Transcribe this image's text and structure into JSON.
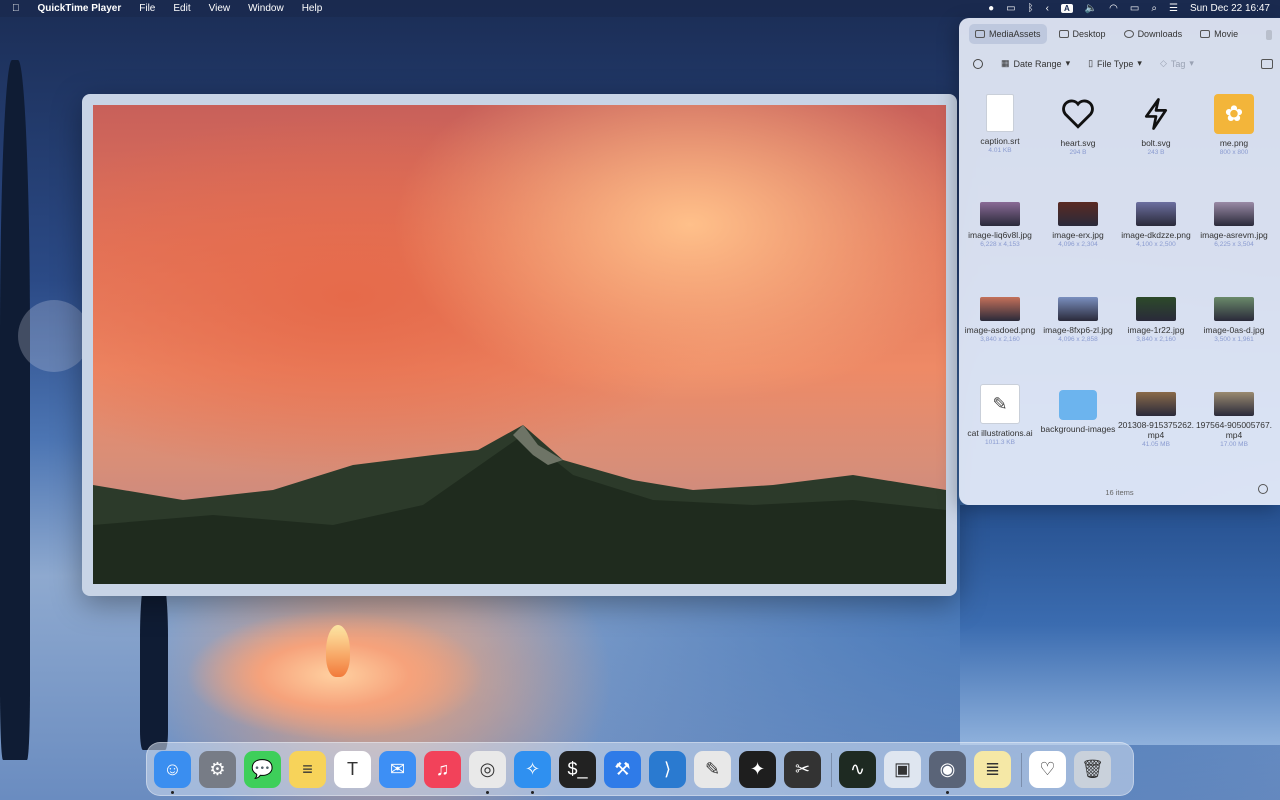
{
  "menubar": {
    "app_name": "QuickTime Player",
    "menus": [
      "File",
      "Edit",
      "View",
      "Window",
      "Help"
    ],
    "input_source": "A",
    "datetime": "Sun Dec 22  16:47"
  },
  "panel": {
    "tabs": [
      {
        "label": "MediaAssets",
        "icon": "folder-icon",
        "active": true
      },
      {
        "label": "Desktop",
        "icon": "desktop-icon",
        "active": false
      },
      {
        "label": "Downloads",
        "icon": "download-icon",
        "active": false
      },
      {
        "label": "Movie",
        "icon": "film-icon",
        "active": false
      }
    ],
    "filters": {
      "date_range": "Date Range",
      "file_type": "File Type",
      "tag": "Tag"
    },
    "files": [
      {
        "name": "caption.srt",
        "meta": "4.01 KB",
        "kind": "doc"
      },
      {
        "name": "heart.svg",
        "meta": "294 B",
        "kind": "heart"
      },
      {
        "name": "bolt.svg",
        "meta": "243 B",
        "kind": "bolt"
      },
      {
        "name": "me.png",
        "meta": "800 x 800",
        "kind": "bunny"
      },
      {
        "name": "image-liq6v8l.jpg",
        "meta": "6,228 x 4,153",
        "kind": "img",
        "color": "#8a6a96"
      },
      {
        "name": "image-erx.jpg",
        "meta": "4,096 x 2,304",
        "kind": "img",
        "color": "#5a2a22"
      },
      {
        "name": "image-dkdzze.png",
        "meta": "4,100 x 2,500",
        "kind": "img",
        "color": "#6c6fa0"
      },
      {
        "name": "image-asrevm.jpg",
        "meta": "6,225 x 3,504",
        "kind": "img",
        "color": "#9a8aa6"
      },
      {
        "name": "image-asdoed.png",
        "meta": "3,840 x 2,160",
        "kind": "img",
        "color": "#c4705a"
      },
      {
        "name": "image-8fxp6-zl.jpg",
        "meta": "4,096 x 2,858",
        "kind": "img",
        "color": "#7a8fbf"
      },
      {
        "name": "image-1r22.jpg",
        "meta": "3,840 x 2,160",
        "kind": "img",
        "color": "#2c4a2a"
      },
      {
        "name": "image-0as-d.jpg",
        "meta": "3,500 x 1,961",
        "kind": "img",
        "color": "#6a8a6a"
      },
      {
        "name": "cat illustrations.ai",
        "meta": "1011.3 KB",
        "kind": "cat"
      },
      {
        "name": "background-images",
        "meta": "",
        "kind": "folder"
      },
      {
        "name": "201308-915375262.mp4",
        "meta": "41.05 MB",
        "kind": "img",
        "color": "#8a6a4a"
      },
      {
        "name": "197564-905005767.mp4",
        "meta": "17.00 MB",
        "kind": "img",
        "color": "#9a8a70"
      }
    ],
    "item_count": "16 items"
  },
  "dock": {
    "apps": [
      {
        "name": "finder",
        "color": "#3a8ef0",
        "glyph": "☺",
        "running": true
      },
      {
        "name": "system-settings",
        "color": "#777c86",
        "glyph": "⚙",
        "running": false
      },
      {
        "name": "messages",
        "color": "#3ecf5a",
        "glyph": "💬",
        "running": false
      },
      {
        "name": "notes",
        "color": "#f7d35a",
        "glyph": "≡",
        "running": false
      },
      {
        "name": "typora",
        "color": "#ffffff",
        "glyph": "T",
        "running": false
      },
      {
        "name": "mail",
        "color": "#3d8ff5",
        "glyph": "✉",
        "running": false
      },
      {
        "name": "music",
        "color": "#f2425a",
        "glyph": "♫",
        "running": false
      },
      {
        "name": "chrome",
        "color": "#e9e9e9",
        "glyph": "◎",
        "running": true
      },
      {
        "name": "safari",
        "color": "#2f90f0",
        "glyph": "✧",
        "running": true
      },
      {
        "name": "terminal",
        "color": "#222222",
        "glyph": "$_",
        "running": false
      },
      {
        "name": "xcode",
        "color": "#2f7be8",
        "glyph": "⚒",
        "running": false
      },
      {
        "name": "vscode",
        "color": "#2a7ad0",
        "glyph": "⟩",
        "running": false
      },
      {
        "name": "pixelmator",
        "color": "#e8e8e8",
        "glyph": "✎",
        "running": false
      },
      {
        "name": "figma",
        "color": "#1e1e1e",
        "glyph": "✦",
        "running": false
      },
      {
        "name": "final-cut",
        "color": "#333333",
        "glyph": "✂",
        "running": false
      },
      {
        "name": "activity-monitor",
        "color": "#1e2a22",
        "glyph": "∿",
        "running": false
      },
      {
        "name": "preview",
        "color": "#dfe6f0",
        "glyph": "▣",
        "running": false
      },
      {
        "name": "quicktime",
        "color": "#5a6478",
        "glyph": "◉",
        "running": true
      },
      {
        "name": "notes-2",
        "color": "#f5e8a6",
        "glyph": "≣",
        "running": false
      },
      {
        "name": "heart-app",
        "color": "#ffffff",
        "glyph": "♡",
        "running": false
      },
      {
        "name": "trash",
        "color": "#c9d1db",
        "glyph": "🗑",
        "running": false
      }
    ]
  }
}
